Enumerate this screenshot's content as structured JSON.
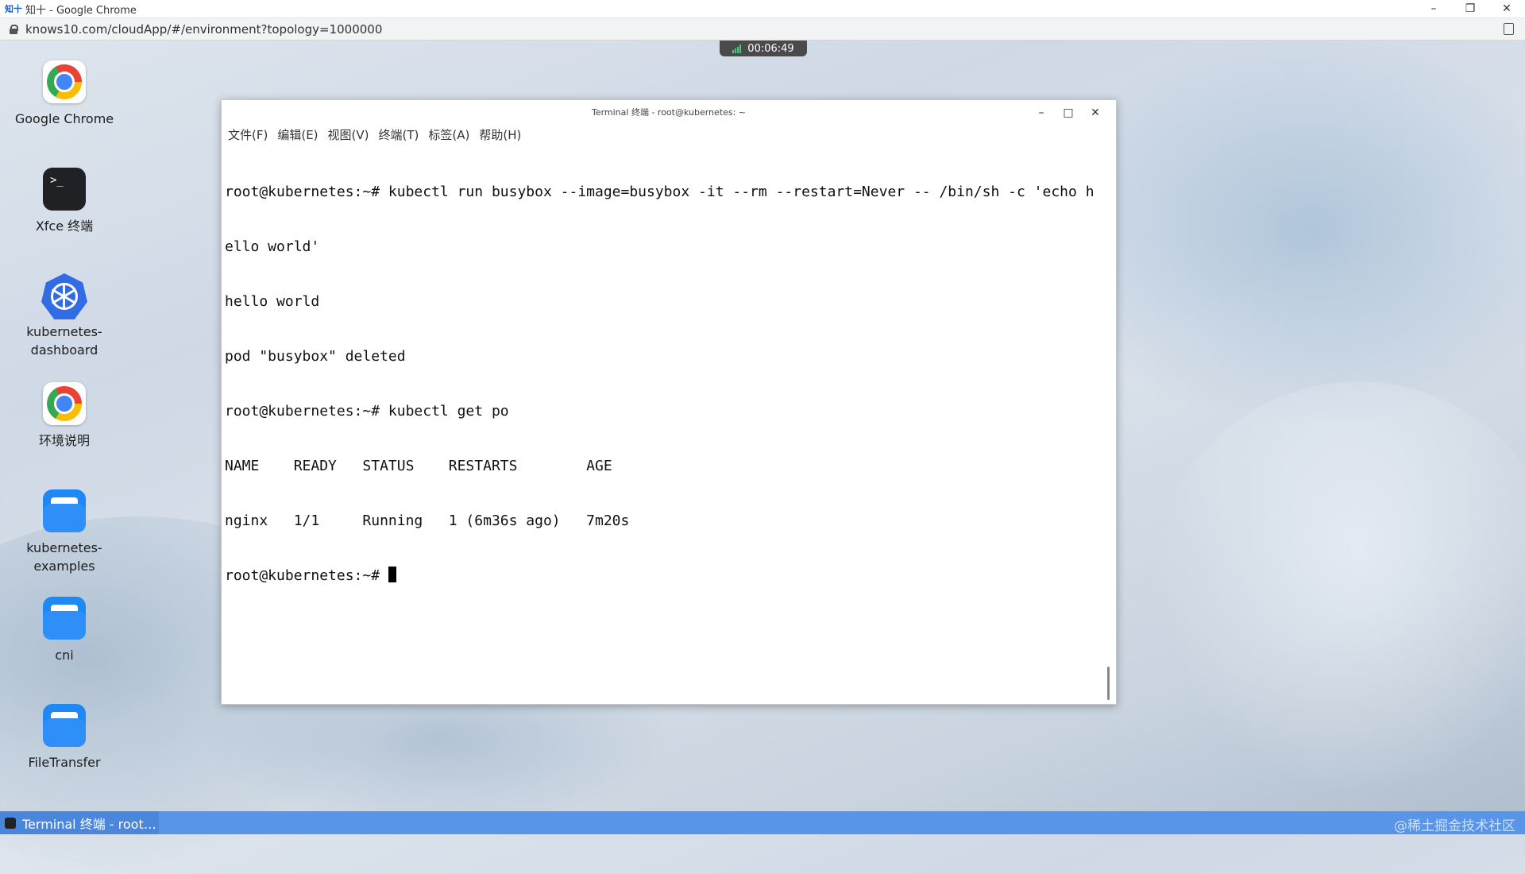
{
  "browser": {
    "title": "知十 - Google Chrome",
    "title_logo": "知十",
    "url": "knows10.com/cloudApp/#/environment?topology=1000000",
    "controls": {
      "minimize": "–",
      "restore": "❐",
      "close": "✕"
    }
  },
  "timer": {
    "value": "00:06:49"
  },
  "desktop": {
    "icons": [
      {
        "label": "Google Chrome",
        "icon": "chrome-icon"
      },
      {
        "label": "Xfce 终端",
        "icon": "terminal-icon"
      },
      {
        "label_line1": "kubernetes-",
        "label_line2": "dashboard",
        "icon": "kubernetes-icon"
      },
      {
        "label": "环境说明",
        "icon": "chrome-icon"
      },
      {
        "label_line1": "kubernetes-",
        "label_line2": "examples",
        "icon": "folder-icon"
      },
      {
        "label": "cni",
        "icon": "folder-icon"
      },
      {
        "label": "FileTransfer",
        "icon": "folder-icon"
      }
    ]
  },
  "terminal": {
    "title": "Terminal 终端 - root@kubernetes: ~",
    "controls": {
      "minimize": "–",
      "maximize": "□",
      "close": "✕"
    },
    "menu": [
      "文件(F)",
      "编辑(E)",
      "视图(V)",
      "终端(T)",
      "标签(A)",
      "帮助(H)"
    ],
    "lines": [
      "root@kubernetes:~# kubectl run busybox --image=busybox -it --rm --restart=Never -- /bin/sh -c 'echo h",
      "ello world'",
      "hello world",
      "pod \"busybox\" deleted",
      "root@kubernetes:~# kubectl get po",
      "NAME    READY   STATUS    RESTARTS        AGE",
      "nginx   1/1     Running   1 (6m36s ago)   7m20s"
    ],
    "prompt": "root@kubernetes:~# "
  },
  "taskbar": {
    "item": "Terminal 终端 - root…",
    "watermark": "@稀土掘金技术社区"
  },
  "colors": {
    "accent": "#326ce5",
    "taskbar": "#5895e8",
    "folder": "#1e88f5"
  }
}
